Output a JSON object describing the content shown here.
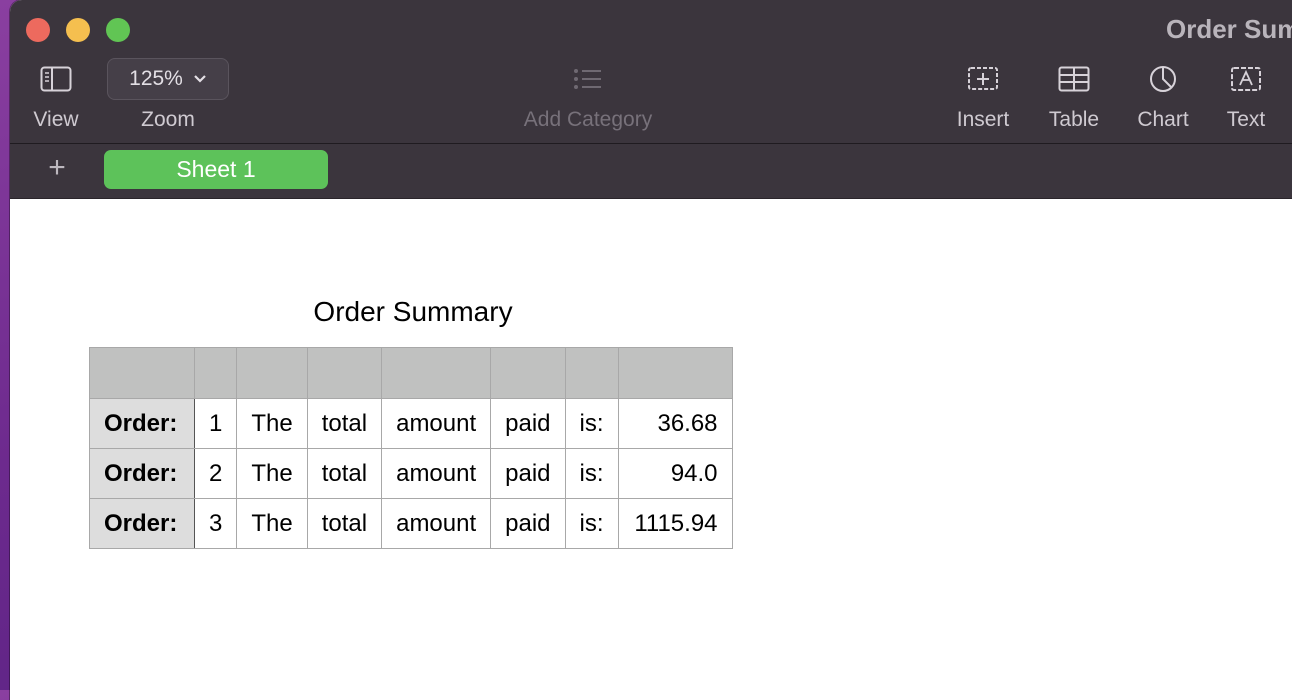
{
  "window": {
    "title": "Order Sum"
  },
  "toolbar": {
    "view_label": "View",
    "zoom_value": "125%",
    "zoom_label": "Zoom",
    "add_category_label": "Add Category",
    "insert_label": "Insert",
    "table_label": "Table",
    "chart_label": "Chart",
    "text_label": "Text"
  },
  "tabs": {
    "add_sheet": "+",
    "sheets": [
      {
        "label": "Sheet 1",
        "selected": true,
        "color": "#5dc25a"
      }
    ]
  },
  "table": {
    "title": "Order Summary",
    "rows": [
      [
        "Order:",
        "1",
        "The",
        "total",
        "amount",
        "paid",
        "is:",
        "36.68"
      ],
      [
        "Order:",
        "2",
        "The",
        "total",
        "amount",
        "paid",
        "is:",
        "94.0"
      ],
      [
        "Order:",
        "3",
        "The",
        "total",
        "amount",
        "paid",
        "is:",
        "1115.94"
      ]
    ]
  }
}
